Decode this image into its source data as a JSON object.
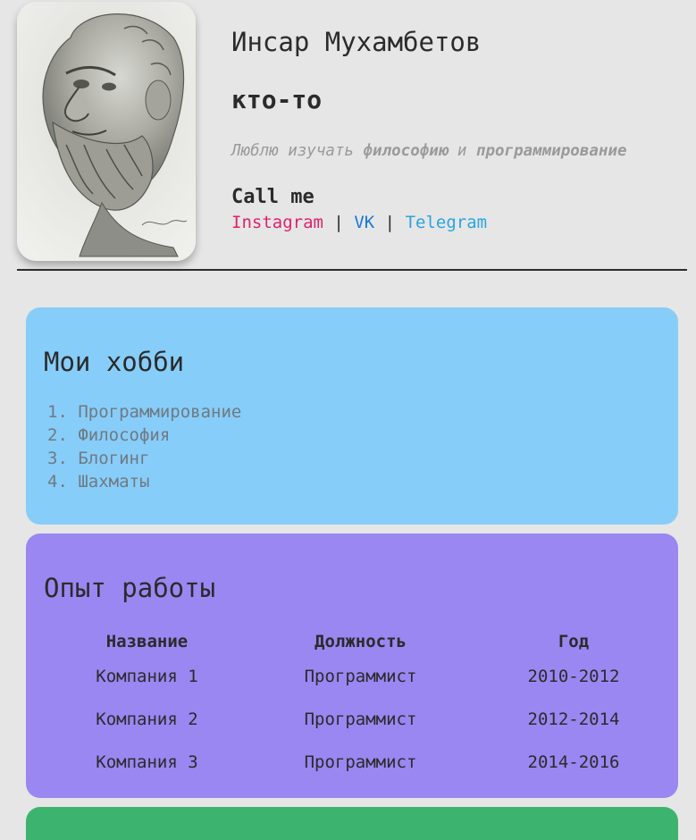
{
  "profile": {
    "photo_alt": "Socrates bust drawing",
    "name": "Инсар Мухамбетов",
    "role": "кто-то",
    "about_prefix": "Люблю изучать ",
    "about_em1": "философию",
    "about_middle": " и ",
    "about_em2": "программирование"
  },
  "contacts": {
    "heading": "Call me",
    "links": [
      {
        "label": "Instagram",
        "color": "#e0226a"
      },
      {
        "label": "VK",
        "color": "#1a78d8"
      },
      {
        "label": "Telegram",
        "color": "#2aa4e3"
      }
    ],
    "separator": "|"
  },
  "hobbies": {
    "title": "Мои хобби",
    "items": [
      {
        "num": "1.",
        "label": "Программирование"
      },
      {
        "num": "2.",
        "label": "Философия"
      },
      {
        "num": "3.",
        "label": "Блогинг"
      },
      {
        "num": "4.",
        "label": "Шахматы"
      }
    ],
    "color": "#87cdf9"
  },
  "work": {
    "title": "Опыт работы",
    "headers": [
      "Название",
      "Должность",
      "Год"
    ],
    "rows": [
      [
        "Компания 1",
        "Программист",
        "2010-2012"
      ],
      [
        "Компания 2",
        "Программист",
        "2012-2014"
      ],
      [
        "Компания 3",
        "Программист",
        "2014-2016"
      ]
    ],
    "color": "#9a87f2"
  },
  "next_section": {
    "color": "#3db370"
  }
}
